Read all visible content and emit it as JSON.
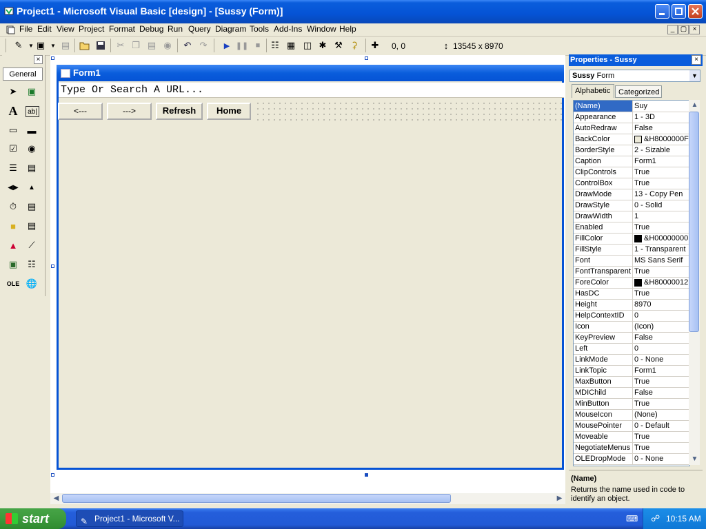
{
  "window": {
    "title": "Project1 - Microsoft Visual Basic [design] - [Sussy (Form)]"
  },
  "menu": [
    "File",
    "Edit",
    "View",
    "Project",
    "Format",
    "Debug",
    "Run",
    "Query",
    "Diagram",
    "Tools",
    "Add-Ins",
    "Window",
    "Help"
  ],
  "toolbar": {
    "position": "0, 0",
    "size": "13545 x 8970"
  },
  "toolbox": {
    "tab_label": "General"
  },
  "form": {
    "title": "Form1",
    "url_placeholder": "Type Or Search A URL...",
    "buttons": {
      "back": "<---",
      "forward": "--->",
      "refresh": "Refresh",
      "home": "Home"
    }
  },
  "properties": {
    "title": "Properties - Sussy",
    "object_name": "Sussy",
    "object_type": "Form",
    "tabs": {
      "alphabetic": "Alphabetic",
      "categorized": "Categorized"
    },
    "rows": [
      {
        "name": "(Name)",
        "value": "Suy"
      },
      {
        "name": "Appearance",
        "value": "1 - 3D"
      },
      {
        "name": "AutoRedraw",
        "value": "False"
      },
      {
        "name": "BackColor",
        "value": "&H8000000F",
        "swatch": "#ece9d8"
      },
      {
        "name": "BorderStyle",
        "value": "2 - Sizable"
      },
      {
        "name": "Caption",
        "value": "Form1"
      },
      {
        "name": "ClipControls",
        "value": "True"
      },
      {
        "name": "ControlBox",
        "value": "True"
      },
      {
        "name": "DrawMode",
        "value": "13 - Copy Pen"
      },
      {
        "name": "DrawStyle",
        "value": "0 - Solid"
      },
      {
        "name": "DrawWidth",
        "value": "1"
      },
      {
        "name": "Enabled",
        "value": "True"
      },
      {
        "name": "FillColor",
        "value": "&H00000000",
        "swatch": "#000000"
      },
      {
        "name": "FillStyle",
        "value": "1 - Transparent"
      },
      {
        "name": "Font",
        "value": "MS Sans Serif"
      },
      {
        "name": "FontTransparent",
        "value": "True"
      },
      {
        "name": "ForeColor",
        "value": "&H80000012",
        "swatch": "#000000"
      },
      {
        "name": "HasDC",
        "value": "True"
      },
      {
        "name": "Height",
        "value": "8970"
      },
      {
        "name": "HelpContextID",
        "value": "0"
      },
      {
        "name": "Icon",
        "value": "(Icon)"
      },
      {
        "name": "KeyPreview",
        "value": "False"
      },
      {
        "name": "Left",
        "value": "0"
      },
      {
        "name": "LinkMode",
        "value": "0 - None"
      },
      {
        "name": "LinkTopic",
        "value": "Form1"
      },
      {
        "name": "MaxButton",
        "value": "True"
      },
      {
        "name": "MDIChild",
        "value": "False"
      },
      {
        "name": "MinButton",
        "value": "True"
      },
      {
        "name": "MouseIcon",
        "value": "(None)"
      },
      {
        "name": "MousePointer",
        "value": "0 - Default"
      },
      {
        "name": "Moveable",
        "value": "True"
      },
      {
        "name": "NegotiateMenus",
        "value": "True"
      },
      {
        "name": "OLEDropMode",
        "value": "0 - None"
      }
    ],
    "description_title": "(Name)",
    "description_text": "Returns the name used in code to identify an object."
  },
  "taskbar": {
    "start_label": "start",
    "task_label": "Project1 - Microsoft V...",
    "clock": "10:15 AM"
  },
  "colors": {
    "title_blue": "#0553d5",
    "selection": "#316ac5",
    "start_green": "#3c9a3c"
  }
}
